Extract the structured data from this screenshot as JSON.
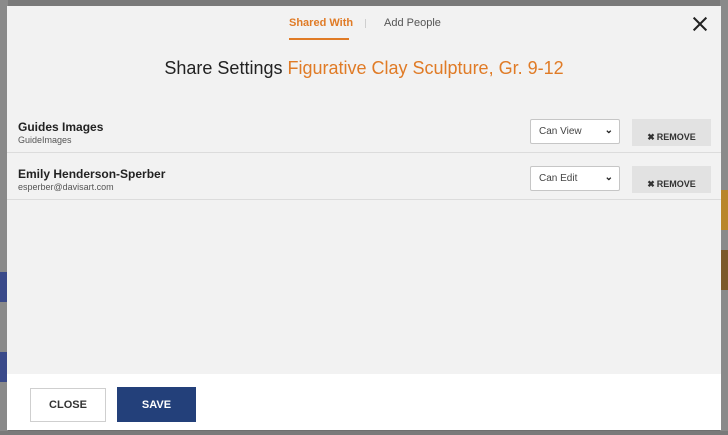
{
  "tabs": [
    {
      "label": "Shared With",
      "active": true
    },
    {
      "label": "Add People",
      "active": false
    }
  ],
  "title": {
    "prefix": "Share Settings",
    "course": "Figurative Clay Sculpture, Gr. 9-12"
  },
  "shares": [
    {
      "name": "Guides Images",
      "sub": "GuideImages",
      "permission": "Can View",
      "remove_label": "REMOVE"
    },
    {
      "name": "Emily Henderson-Sperber",
      "sub": "esperber@davisart.com",
      "permission": "Can Edit",
      "remove_label": "REMOVE"
    }
  ],
  "footer": {
    "close_label": "CLOSE",
    "save_label": "SAVE"
  },
  "colors": {
    "accent": "#e07b26",
    "primary": "#23407a",
    "panel": "#f2f2f2"
  },
  "icons": {
    "close": "close-icon",
    "remove": "x-icon",
    "dropdown": "chevron-down-icon"
  }
}
